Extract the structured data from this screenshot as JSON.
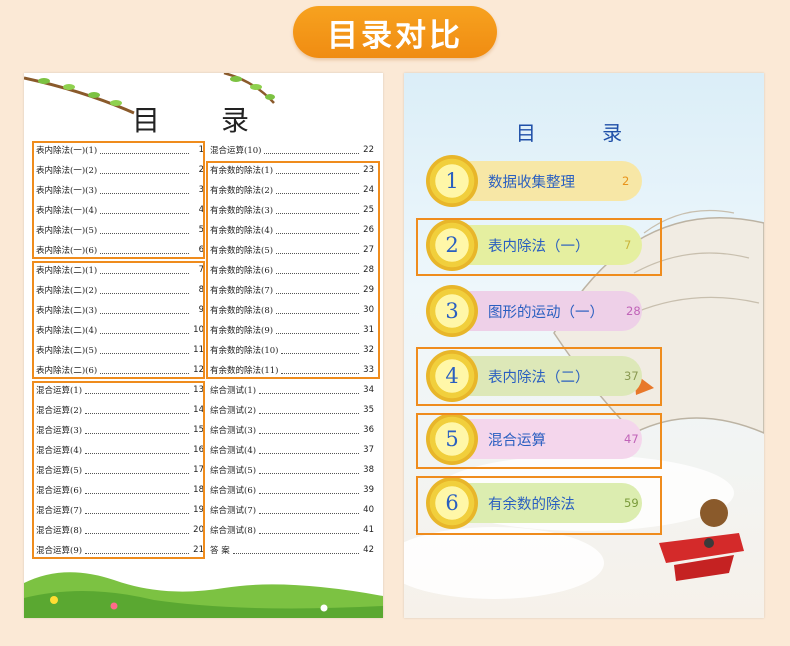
{
  "banner": {
    "title": "目录对比"
  },
  "left_page": {
    "title": "目 录",
    "col1": [
      {
        "label": "表内除法(一)(1)",
        "page": "1"
      },
      {
        "label": "表内除法(一)(2)",
        "page": "2"
      },
      {
        "label": "表内除法(一)(3)",
        "page": "3"
      },
      {
        "label": "表内除法(一)(4)",
        "page": "4"
      },
      {
        "label": "表内除法(一)(5)",
        "page": "5"
      },
      {
        "label": "表内除法(一)(6)",
        "page": "6"
      },
      {
        "label": "表内除法(二)(1)",
        "page": "7"
      },
      {
        "label": "表内除法(二)(2)",
        "page": "8"
      },
      {
        "label": "表内除法(二)(3)",
        "page": "9"
      },
      {
        "label": "表内除法(二)(4)",
        "page": "10"
      },
      {
        "label": "表内除法(二)(5)",
        "page": "11"
      },
      {
        "label": "表内除法(二)(6)",
        "page": "12"
      },
      {
        "label": "混合运算(1)",
        "page": "13"
      },
      {
        "label": "混合运算(2)",
        "page": "14"
      },
      {
        "label": "混合运算(3)",
        "page": "15"
      },
      {
        "label": "混合运算(4)",
        "page": "16"
      },
      {
        "label": "混合运算(5)",
        "page": "17"
      },
      {
        "label": "混合运算(6)",
        "page": "18"
      },
      {
        "label": "混合运算(7)",
        "page": "19"
      },
      {
        "label": "混合运算(8)",
        "page": "20"
      },
      {
        "label": "混合运算(9)",
        "page": "21"
      }
    ],
    "col2": [
      {
        "label": "混合运算(10)",
        "page": "22"
      },
      {
        "label": "有余数的除法(1)",
        "page": "23"
      },
      {
        "label": "有余数的除法(2)",
        "page": "24"
      },
      {
        "label": "有余数的除法(3)",
        "page": "25"
      },
      {
        "label": "有余数的除法(4)",
        "page": "26"
      },
      {
        "label": "有余数的除法(5)",
        "page": "27"
      },
      {
        "label": "有余数的除法(6)",
        "page": "28"
      },
      {
        "label": "有余数的除法(7)",
        "page": "29"
      },
      {
        "label": "有余数的除法(8)",
        "page": "30"
      },
      {
        "label": "有余数的除法(9)",
        "page": "31"
      },
      {
        "label": "有余数的除法(10)",
        "page": "32"
      },
      {
        "label": "有余数的除法(11)",
        "page": "33"
      },
      {
        "label": "综合测试(1)",
        "page": "34"
      },
      {
        "label": "综合测试(2)",
        "page": "35"
      },
      {
        "label": "综合测试(3)",
        "page": "36"
      },
      {
        "label": "综合测试(4)",
        "page": "37"
      },
      {
        "label": "综合测试(5)",
        "page": "38"
      },
      {
        "label": "综合测试(6)",
        "page": "39"
      },
      {
        "label": "综合测试(7)",
        "page": "40"
      },
      {
        "label": "综合测试(8)",
        "page": "41"
      },
      {
        "label": "答 案",
        "page": "42"
      }
    ]
  },
  "right_page": {
    "title": "目 录",
    "units": [
      {
        "num": "1",
        "title": "数据收集整理",
        "page": "2"
      },
      {
        "num": "2",
        "title": "表内除法（一）",
        "page": "7"
      },
      {
        "num": "3",
        "title": "图形的运动（一）",
        "page": "28"
      },
      {
        "num": "4",
        "title": "表内除法（二）",
        "page": "37"
      },
      {
        "num": "5",
        "title": "混合运算",
        "page": "47"
      },
      {
        "num": "6",
        "title": "有余数的除法",
        "page": "59"
      }
    ]
  },
  "colors": {
    "accent_orange": "#ef8c1d",
    "unit_blue": "#2a5fc0",
    "pill_colors": [
      "#f7e7a6",
      "#e5efa0",
      "#eed0e8",
      "#dde8b8",
      "#f4d6ec",
      "#dcedb0"
    ],
    "page_colors": [
      "#e8931a",
      "#c9b43a",
      "#c063b8",
      "#8a9a52",
      "#c063b8",
      "#7a9a3a"
    ]
  }
}
